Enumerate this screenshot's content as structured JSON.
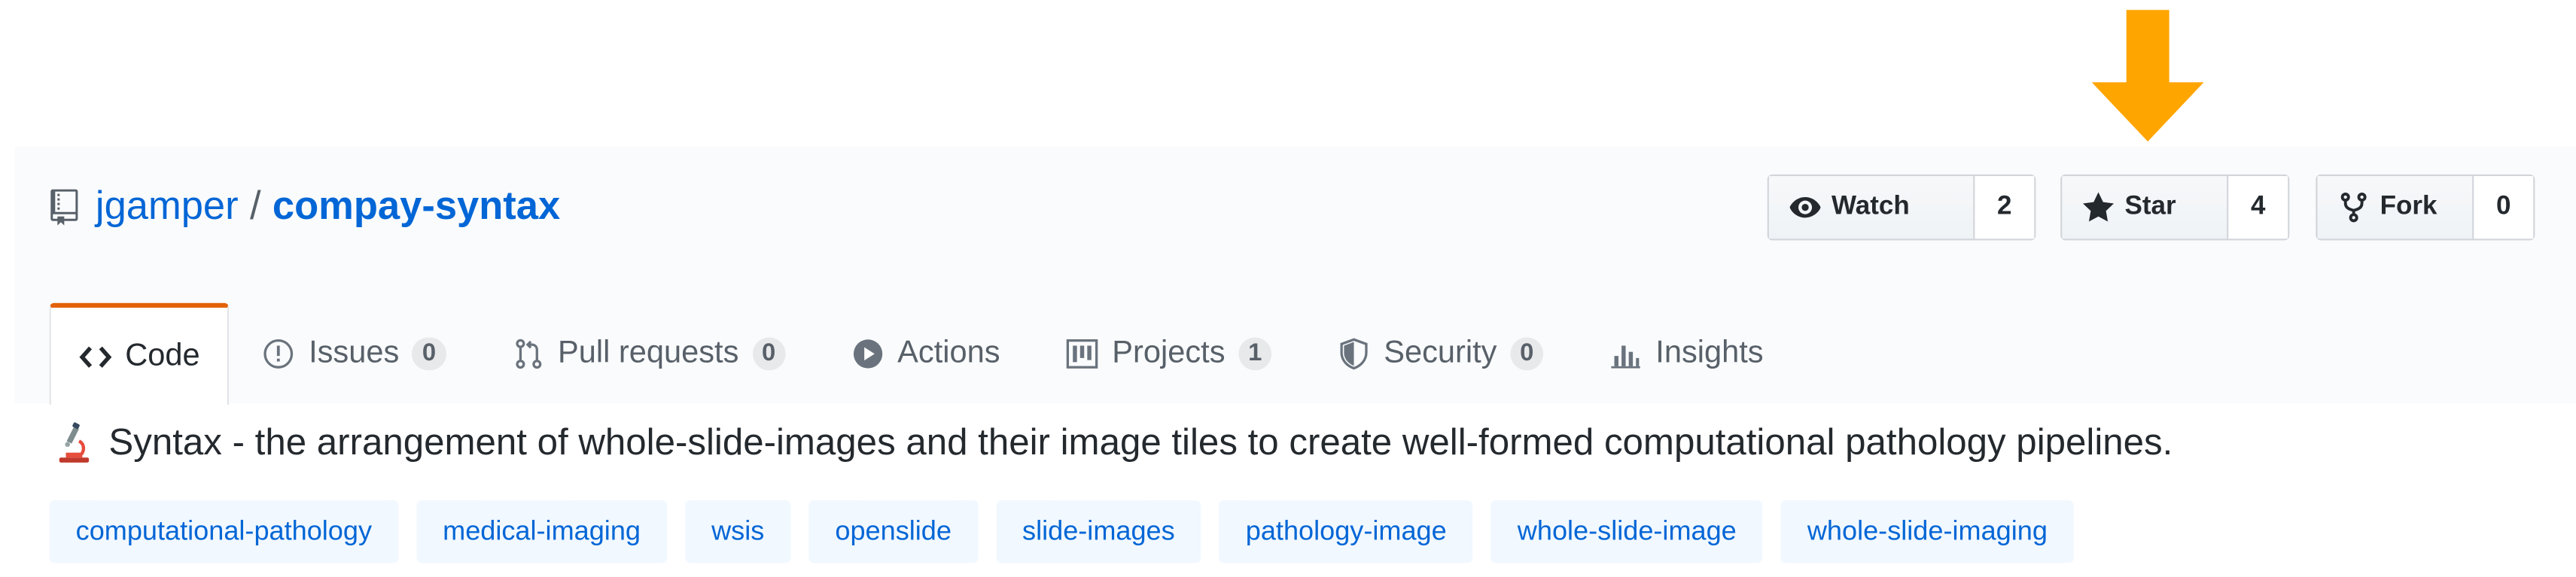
{
  "annotation": {
    "arrow_color": "#ffa500"
  },
  "repo": {
    "icon": "repo-icon",
    "owner": "jgamper",
    "separator": "/",
    "name": "compay-syntax"
  },
  "actions": {
    "watch": {
      "icon": "eye-icon",
      "label": "Watch",
      "count": "2"
    },
    "star": {
      "icon": "star-icon",
      "label": "Star",
      "count": "4"
    },
    "fork": {
      "icon": "fork-icon",
      "label": "Fork",
      "count": "0"
    }
  },
  "tabs": [
    {
      "icon": "code-icon",
      "label": "Code",
      "selected": true
    },
    {
      "icon": "issue-icon",
      "label": "Issues",
      "count": "0"
    },
    {
      "icon": "pull-request-icon",
      "label": "Pull requests",
      "count": "0"
    },
    {
      "icon": "play-icon",
      "label": "Actions"
    },
    {
      "icon": "project-icon",
      "label": "Projects",
      "count": "1"
    },
    {
      "icon": "shield-icon",
      "label": "Security",
      "count": "0"
    },
    {
      "icon": "graph-icon",
      "label": "Insights"
    }
  ],
  "description": {
    "icon": "microscope-icon",
    "text": "Syntax - the arrangement of whole-slide-images and their image tiles to create well-formed computational pathology pipelines."
  },
  "topics": [
    "computational-pathology",
    "medical-imaging",
    "wsis",
    "openslide",
    "slide-images",
    "pathology-image",
    "whole-slide-image",
    "whole-slide-imaging"
  ],
  "colors": {
    "link": "#0366d6",
    "tab_accent": "#e36209",
    "topic_bg": "#f1f8ff"
  }
}
